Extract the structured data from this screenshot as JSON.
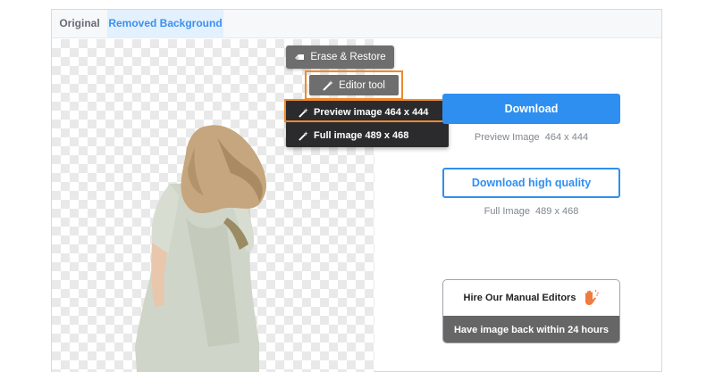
{
  "tabs": [
    {
      "label": "Original",
      "active": false
    },
    {
      "label": "Removed Background",
      "active": true
    }
  ],
  "editor": {
    "erase_label": "Erase & Restore",
    "editor_tool_label": "Editor tool",
    "menu": [
      {
        "label": "Preview image 464 x 444",
        "highlighted": true
      },
      {
        "label": "Full image 489 x 468",
        "highlighted": false
      }
    ]
  },
  "downloads": {
    "download_label": "Download",
    "preview_info": "Preview Image  464 x 444",
    "hq_label": "Download high quality",
    "full_info": "Full Image  489 x 468"
  },
  "hire": {
    "title": "Hire Our Manual Editors",
    "subtitle": "Have image back within 24 hours"
  },
  "icons": {
    "eraser": "eraser-icon",
    "magic_wand": "magic-wand-icon",
    "hand": "waving-hand-icon"
  },
  "colors": {
    "accent": "#2f8ff0",
    "highlight": "#f08a2c",
    "dark_menu": "#2b2b2e",
    "button_gray": "#6e6e6e"
  }
}
